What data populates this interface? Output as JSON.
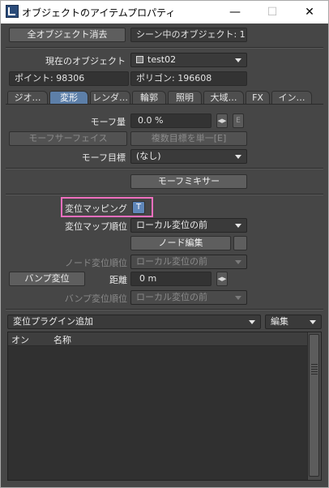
{
  "window": {
    "title": "オブジェクトのアイテムプロパティ",
    "controls": {
      "minimize": "—",
      "maximize": "☐",
      "close": "✕"
    }
  },
  "top": {
    "clear_all": "全オブジェクト消去",
    "scene_objects": "シーン中のオブジェクト: 1",
    "current_object_label": "現在のオブジェクト",
    "current_object_value": "test02",
    "points": "ポイント: 98306",
    "polygons": "ポリゴン: 196608"
  },
  "tabs": [
    "ジオ…",
    "変形",
    "レンダ…",
    "輪郭",
    "照明",
    "大域…",
    "FX",
    "イン…"
  ],
  "active_tab": "変形",
  "morph": {
    "amount_label": "モーフ量",
    "amount_value": "0.0 %",
    "env_label": "E",
    "surface_button": "モーフサーフェイス",
    "multi_target_button": "複数目標を単一[E]",
    "target_label": "モーフ目標",
    "target_value": "(なし)",
    "mixer_button": "モーフミキサー"
  },
  "displacement": {
    "mapping_label": "変位マッピング",
    "mapping_button": "T",
    "map_order_label": "変位マップ順位",
    "map_order_value": "ローカル変位の前",
    "node_edit_button": "ノード編集",
    "node_order_label": "ノード変位順位",
    "node_order_value": "ローカル変位の前",
    "bump_button": "バンプ変位",
    "distance_label": "距離",
    "distance_value": "0 m",
    "bump_order_label": "バンプ変位順位",
    "bump_order_value": "ローカル変位の前"
  },
  "plugins": {
    "add_dropdown": "変位プラグイン追加",
    "edit_dropdown": "編集",
    "columns": [
      "オン",
      "名称"
    ]
  }
}
